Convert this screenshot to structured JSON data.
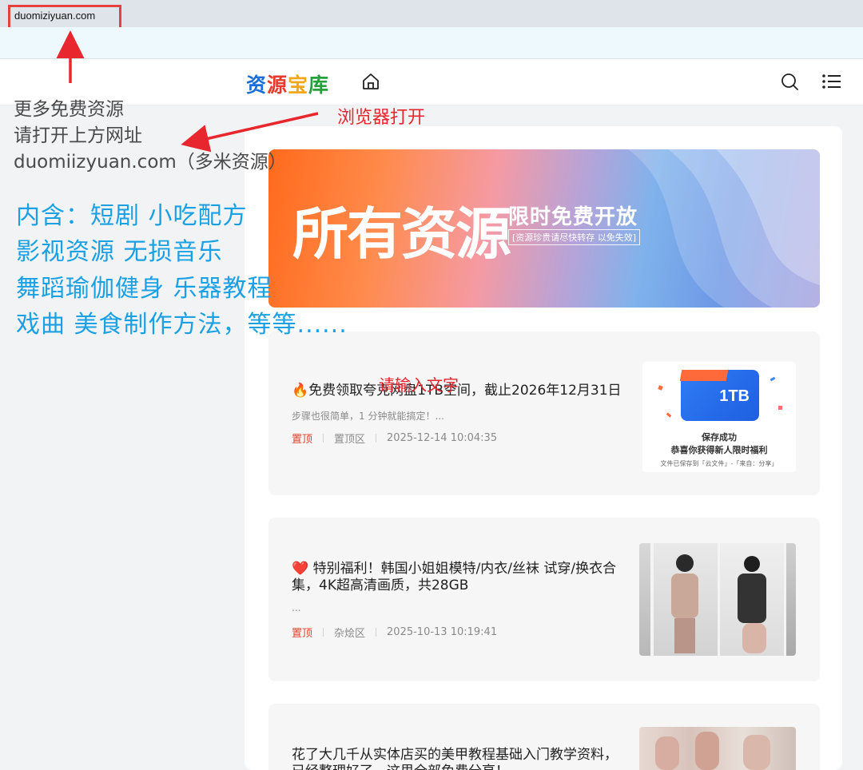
{
  "browser": {
    "url": "duomiziyuan.com"
  },
  "site": {
    "logo_chars": [
      "资",
      "源",
      "宝",
      "库"
    ]
  },
  "banner": {
    "title": "所有资源",
    "subtitle": "限时免费开放",
    "note": "[资源珍贵请尽快转存 以免失效]"
  },
  "posts": [
    {
      "title": "🔥免费领取夸克网盘1TB空间，截止2026年12月31日",
      "excerpt": "步骤也很简单，1 分钟就能搞定！...",
      "pin_label": "置顶",
      "category": "置顶区",
      "date": "2025-12-14 10:04:35",
      "thumb": {
        "badge": "1TB",
        "line1": "保存成功",
        "line2": "恭喜你获得新人限时福利",
        "line3": "文件已保存到「云文件」-「来自：分享」"
      }
    },
    {
      "title": "❤️ 特别福利！韩国小姐姐模特/内衣/丝袜 试穿/换衣合集，4K超高清画质，共28GB",
      "excerpt": "...",
      "pin_label": "置顶",
      "category": "杂烩区",
      "date": "2025-10-13 10:19:41"
    },
    {
      "title": "花了大几千从实体店买的美甲教程基础入门教学资料，已经整理好了，这里全部免费分享！"
    }
  ],
  "annotations": {
    "gray_lines": [
      "更多免费资源",
      "请打开上方网址",
      "duomiizyuan.com（多米资源）"
    ],
    "blue_lines": [
      "内含：短剧 小吃配方",
      "影视资源 无损音乐",
      "舞蹈瑜伽健身 乐器教程",
      "戏曲 美食制作方法，等等......"
    ],
    "browser_open": "浏览器打开",
    "input_hint": "请输入文字"
  },
  "colors": {
    "accent_red": "#e8262d",
    "annotation_blue": "#1aa0e3",
    "pin_red": "#e5402b"
  },
  "icons": [
    "home-icon",
    "search-icon",
    "menu-icon"
  ]
}
